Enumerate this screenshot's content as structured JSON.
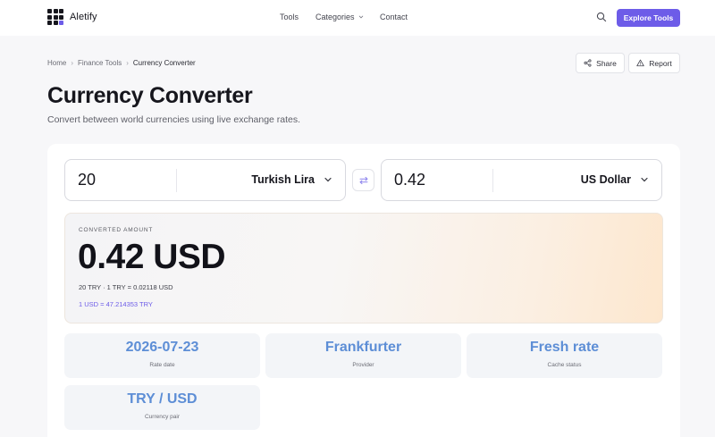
{
  "header": {
    "brand": "Aletify",
    "nav": {
      "tools": "Tools",
      "categories": "Categories",
      "contact": "Contact"
    },
    "cta": "Explore Tools"
  },
  "breadcrumb": {
    "home": "Home",
    "section": "Finance Tools",
    "current": "Currency Converter"
  },
  "actions": {
    "share": "Share",
    "report": "Report"
  },
  "page": {
    "title": "Currency Converter",
    "subtitle": "Convert between world currencies using live exchange rates."
  },
  "converter": {
    "from": {
      "amount": "20",
      "currency": "Turkish Lira"
    },
    "to": {
      "amount": "0.42",
      "currency": "US Dollar"
    }
  },
  "result": {
    "label": "CONVERTED AMOUNT",
    "value": "0.42 USD",
    "detail": "20 TRY · 1 TRY = 0.02118 USD",
    "inverse": "1 USD = 47.214353 TRY"
  },
  "stats": [
    {
      "value": "2026-07-23",
      "label": "Rate date"
    },
    {
      "value": "Frankfurter",
      "label": "Provider"
    },
    {
      "value": "Fresh rate",
      "label": "Cache status"
    },
    {
      "value": "TRY / USD",
      "label": "Currency pair"
    }
  ],
  "colors": {
    "accent": "#6d5ce8",
    "stat_value": "#5d8ed6",
    "result_highlight": "#fde7ce"
  }
}
